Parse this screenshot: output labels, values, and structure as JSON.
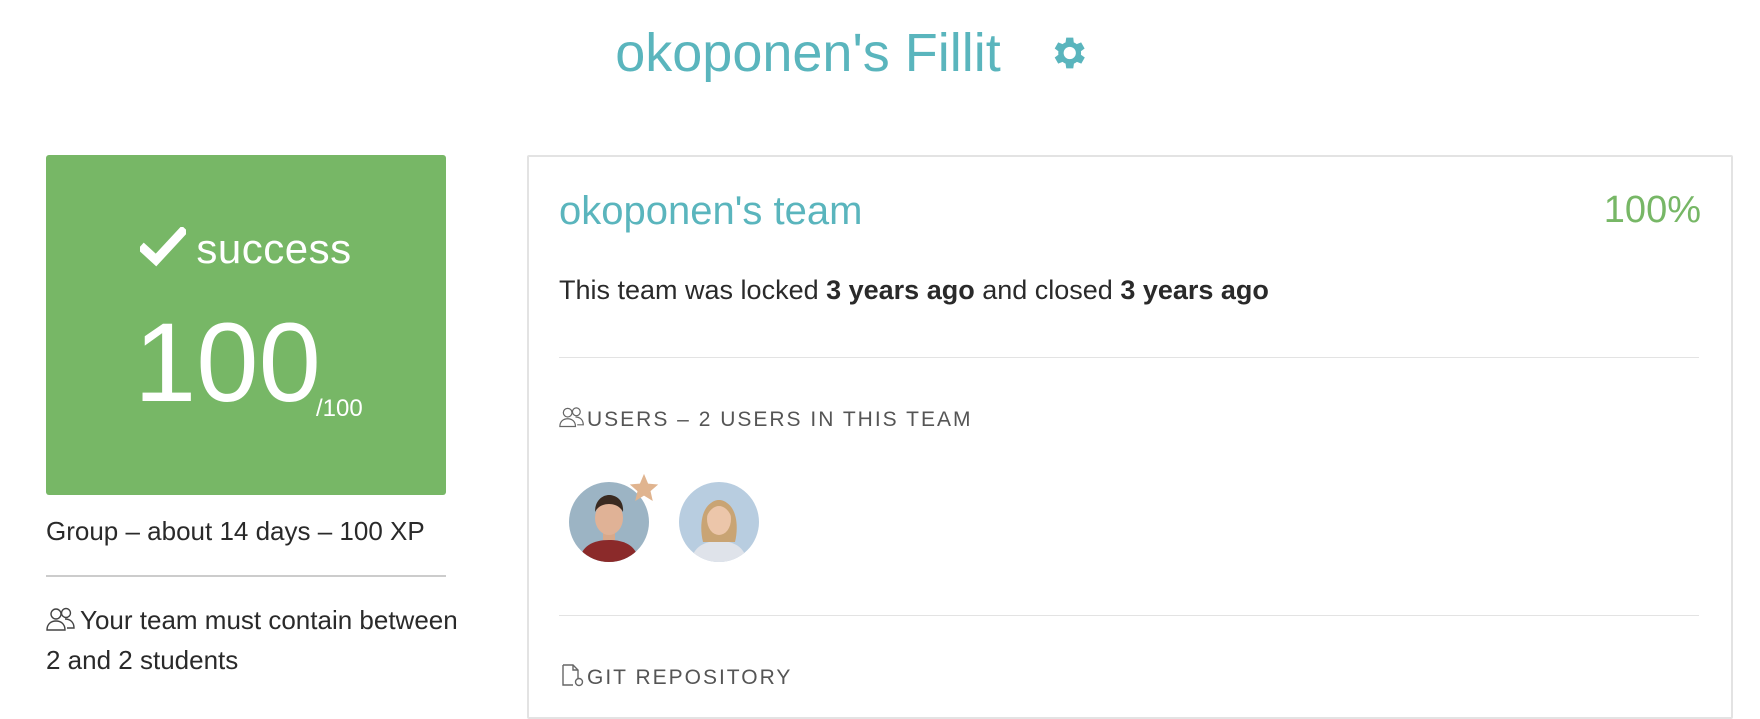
{
  "header": {
    "title": "okoponen's Fillit",
    "settings_icon": "gear-icon"
  },
  "score": {
    "status": "success",
    "value": "100",
    "max": "/100",
    "color": "#77b766"
  },
  "project_meta": {
    "line": "Group – about 14 days – 100 XP",
    "team_rule": "Your team must contain between 2 and 2 students"
  },
  "team": {
    "name": "okoponen's team",
    "percent": "100%",
    "status_prefix": "This team was locked ",
    "locked_ago": "3 years ago",
    "status_middle": " and closed ",
    "closed_ago": "3 years ago",
    "users_header": "Users – 2 users in this team",
    "members": [
      {
        "leader": true,
        "icon": "avatar-male"
      },
      {
        "leader": false,
        "icon": "avatar-female"
      }
    ],
    "git_header": "Git repository"
  },
  "colors": {
    "accent": "#5ab5bd",
    "success": "#77b766",
    "star": "#e0b48f"
  }
}
